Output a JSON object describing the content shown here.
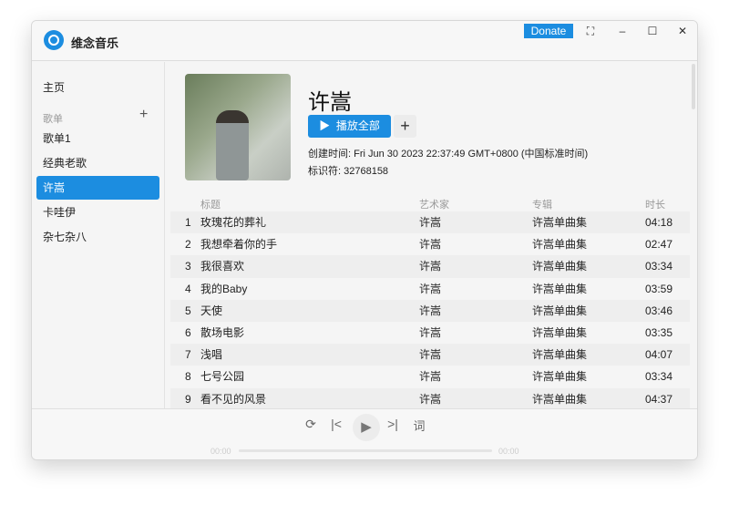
{
  "app": {
    "name": "维念音乐",
    "donate": "Donate",
    "accent": "#1c8de0"
  },
  "sidebar": {
    "home": "主页",
    "playlists_header": "歌单",
    "add_icon": "plus-icon",
    "items": [
      {
        "label": "歌单1"
      },
      {
        "label": "经典老歌"
      },
      {
        "label": "许嵩",
        "active": true
      },
      {
        "label": "卡哇伊"
      },
      {
        "label": "杂七杂八"
      }
    ]
  },
  "playlist": {
    "title": "许嵩",
    "play_all": "播放全部",
    "created": "创建时间:  Fri Jun 30 2023 22:37:49 GMT+0800 (中国标准时间)",
    "id": "标识符:  32768158"
  },
  "table": {
    "headers": {
      "title": "标题",
      "artist": "艺术家",
      "album": "专辑",
      "duration": "时长"
    },
    "rows": [
      {
        "n": "1",
        "title": "玫瑰花的葬礼",
        "artist": "许嵩",
        "album": "许嵩单曲集",
        "duration": "04:18"
      },
      {
        "n": "2",
        "title": "我想牵着你的手",
        "artist": "许嵩",
        "album": "许嵩单曲集",
        "duration": "02:47"
      },
      {
        "n": "3",
        "title": "我很喜欢",
        "artist": "许嵩",
        "album": "许嵩单曲集",
        "duration": "03:34"
      },
      {
        "n": "4",
        "title": "我的Baby",
        "artist": "许嵩",
        "album": "许嵩单曲集",
        "duration": "03:59"
      },
      {
        "n": "5",
        "title": "天使",
        "artist": "许嵩",
        "album": "许嵩单曲集",
        "duration": "03:46"
      },
      {
        "n": "6",
        "title": "散场电影",
        "artist": "许嵩",
        "album": "许嵩单曲集",
        "duration": "03:35"
      },
      {
        "n": "7",
        "title": "浅唱",
        "artist": "许嵩",
        "album": "许嵩单曲集",
        "duration": "04:07"
      },
      {
        "n": "8",
        "title": "七号公园",
        "artist": "许嵩",
        "album": "许嵩单曲集",
        "duration": "03:34"
      },
      {
        "n": "9",
        "title": "看不见的风景",
        "artist": "许嵩",
        "album": "许嵩单曲集",
        "duration": "04:37"
      }
    ]
  },
  "player": {
    "lyrics": "词",
    "current": "00:00",
    "total": "00:00",
    "progress": 0
  }
}
